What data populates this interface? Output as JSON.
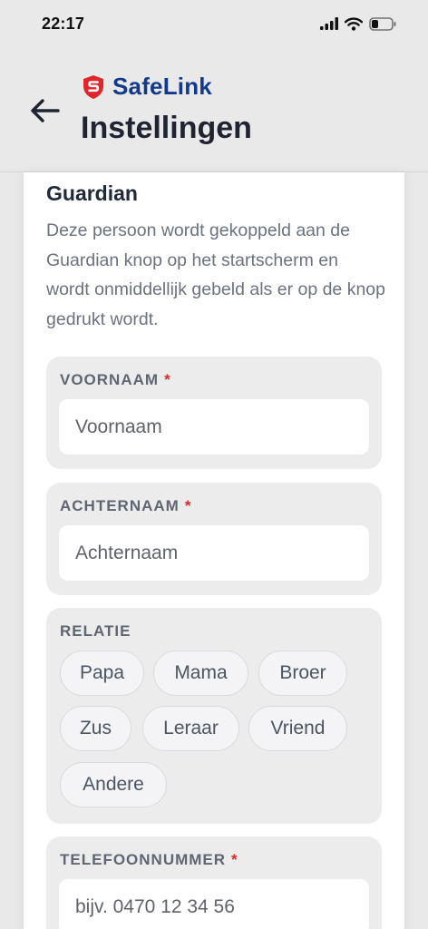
{
  "status_bar": {
    "time": "22:17"
  },
  "header": {
    "brand_name": "SafeLink",
    "title": "Instellingen"
  },
  "guardian": {
    "title": "Guardian",
    "description": "Deze persoon wordt gekoppeld aan de Guardian knop op het startscherm en wordt onmiddellijk gebeld als er op de knop gedrukt wordt.",
    "first_name": {
      "label": "VOORNAAM",
      "required": "*",
      "placeholder": "Voornaam",
      "value": ""
    },
    "last_name": {
      "label": "ACHTERNAAM",
      "required": "*",
      "placeholder": "Achternaam",
      "value": ""
    },
    "relation": {
      "label": "RELATIE",
      "options": [
        "Papa",
        "Mama",
        "Broer",
        "Zus",
        "Leraar",
        "Vriend",
        "Andere"
      ]
    },
    "phone": {
      "label": "TELEFOONNUMMER",
      "required": "*",
      "placeholder": "bijv. 0470 12 34 56",
      "value": ""
    }
  },
  "colors": {
    "brand": "#123a8c",
    "logo_red": "#e0262b",
    "required": "#d92b2b",
    "title": "#1f2430"
  },
  "icons": {
    "back": "arrow-left-icon",
    "logo": "shield-s-icon",
    "signal": "cellular-signal-icon",
    "wifi": "wifi-icon",
    "battery": "battery-icon"
  }
}
